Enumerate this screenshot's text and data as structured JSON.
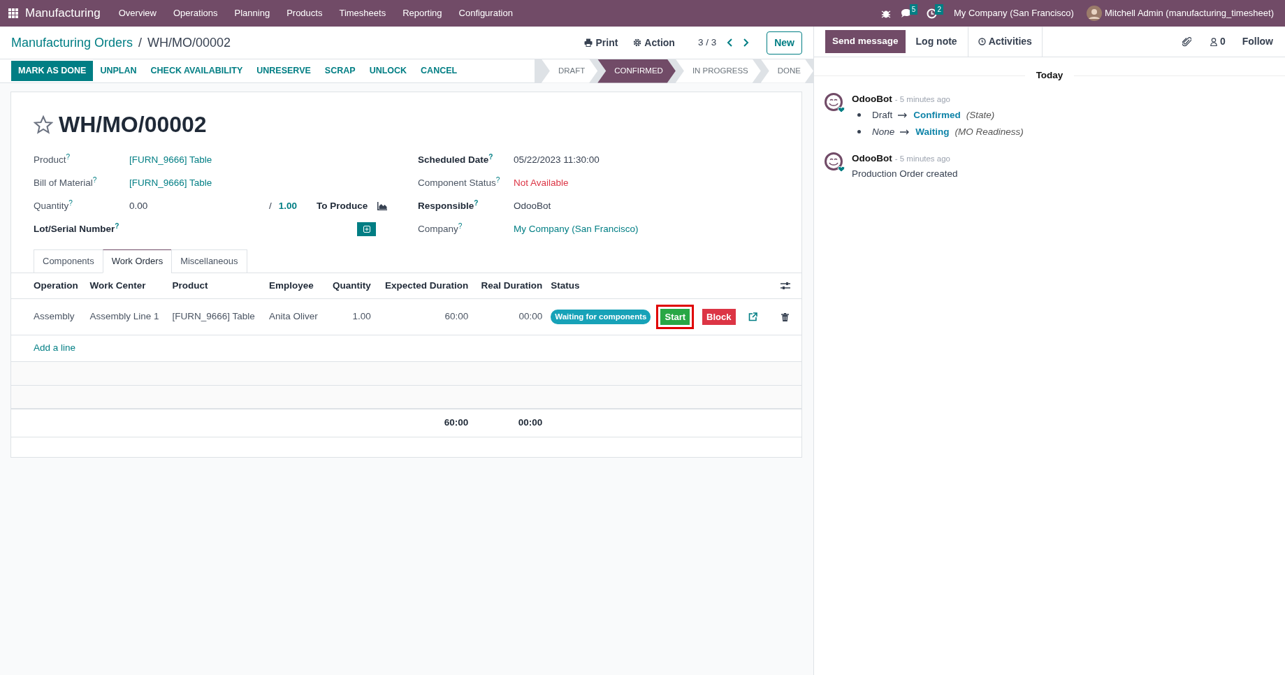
{
  "navbar": {
    "app_name": "Manufacturing",
    "menu": [
      "Overview",
      "Operations",
      "Planning",
      "Products",
      "Timesheets",
      "Reporting",
      "Configuration"
    ],
    "chat_count": "5",
    "activity_count": "2",
    "company": "My Company (San Francisco)",
    "user": "Mitchell Admin (manufacturing_timesheet)"
  },
  "breadcrumb": {
    "parent": "Manufacturing Orders",
    "separator": "/",
    "current": "WH/MO/00002"
  },
  "control": {
    "print": "Print",
    "action": "Action",
    "pager": "3 / 3",
    "new": "New"
  },
  "buttons": [
    {
      "label": "MARK AS DONE",
      "primary": true
    },
    {
      "label": "UNPLAN",
      "primary": false
    },
    {
      "label": "CHECK AVAILABILITY",
      "primary": false
    },
    {
      "label": "UNRESERVE",
      "primary": false
    },
    {
      "label": "SCRAP",
      "primary": false
    },
    {
      "label": "UNLOCK",
      "primary": false
    },
    {
      "label": "CANCEL",
      "primary": false
    }
  ],
  "stages": [
    {
      "label": "DRAFT",
      "selected": false
    },
    {
      "label": "CONFIRMED",
      "selected": true
    },
    {
      "label": "IN PROGRESS",
      "selected": false
    },
    {
      "label": "DONE",
      "selected": false
    }
  ],
  "form": {
    "title": "WH/MO/00002",
    "starred": false,
    "left_fields": [
      {
        "kind": "link",
        "label": "Product$^{?}$",
        "bold": false,
        "value": "[FURN_9666] Table"
      },
      {
        "kind": "link",
        "label": "Bill of Material$^{?}$",
        "bold": false,
        "value": "[FURN_9666] Table"
      },
      {
        "kind": "quantity",
        "label": "Quantity$^{?}$",
        "bold": false,
        "value": "0.00",
        "separator": "/",
        "target": "1.00",
        "unit": "To Produce"
      },
      {
        "kind": "lot",
        "label": "Lot/Serial Number$^{?}$",
        "bold": true
      }
    ],
    "right_fields": [
      {
        "kind": "text",
        "label": "Scheduled Date$^{?}$",
        "bold": true,
        "value": "05/22/2023 11:30:00"
      },
      {
        "kind": "danger",
        "label": "Component Status$^{?}$",
        "bold": false,
        "value": "Not Available"
      },
      {
        "kind": "text",
        "label": "Responsible$^{?}$",
        "bold": true,
        "value": "OdooBot"
      },
      {
        "kind": "link",
        "label": "Company$^{?}$",
        "bold": false,
        "value": "My Company (San Francisco)"
      }
    ]
  },
  "tabs": [
    {
      "label": "Components",
      "selected": false
    },
    {
      "label": "Work Orders",
      "selected": true
    },
    {
      "label": "Miscellaneous",
      "selected": false
    }
  ],
  "table": {
    "columns": [
      {
        "label": "Operation",
        "kind": "text"
      },
      {
        "label": "Work Center",
        "kind": "text"
      },
      {
        "label": "Product",
        "kind": "text"
      },
      {
        "label": "Employee",
        "kind": "text"
      },
      {
        "label": "Quantity",
        "kind": "number"
      },
      {
        "label": "Expected Duration",
        "kind": "number"
      },
      {
        "label": "Real Duration",
        "kind": "number"
      },
      {
        "label": "Status",
        "kind": "text"
      }
    ],
    "rows": [
      {
        "cells": [
          "Assembly",
          "Assembly Line 1",
          "[FURN_9666] Table",
          "Anita Oliver",
          "1.00",
          "60:00",
          "00:00"
        ],
        "status": "Waiting for components",
        "actions": [
          {
            "kind": "start",
            "label": "Start",
            "highlighted": true
          },
          {
            "kind": "block",
            "label": "Block",
            "highlighted": false
          }
        ]
      }
    ],
    "add_line": "Add a line",
    "totals": {
      "expected": "60:00",
      "real": "00:00"
    }
  },
  "chatter": {
    "send_message": "Send message",
    "log_note": "Log note",
    "activities": "Activities",
    "followers": "0",
    "follow": "Follow",
    "date": "Today",
    "messages": [
      {
        "author": "OdooBot",
        "time": "- 5 minutes ago",
        "tracking": [
          {
            "old": "Draft",
            "old_italic": false,
            "new": "Confirmed",
            "field": "(State)"
          },
          {
            "old": "None",
            "old_italic": true,
            "new": "Waiting",
            "field": "(MO Readiness)"
          }
        ]
      },
      {
        "author": "OdooBot",
        "time": "- 5 minutes ago",
        "body": "Production Order created"
      }
    ]
  }
}
